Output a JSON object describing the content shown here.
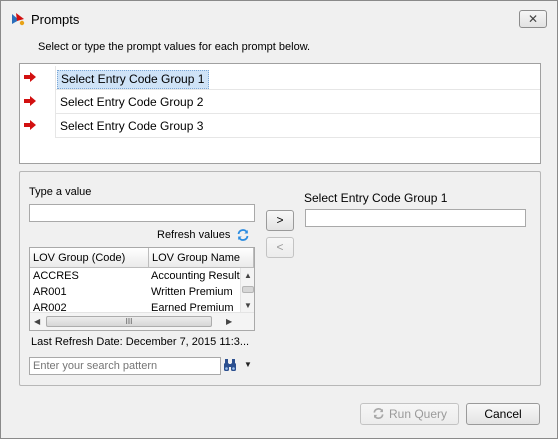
{
  "window": {
    "title": "Prompts",
    "close_symbol": "✕"
  },
  "instruction": "Select or type the prompt values for each prompt below.",
  "prompts": [
    {
      "label": "Select Entry Code Group 1",
      "selected": true
    },
    {
      "label": "Select Entry Code Group 2",
      "selected": false
    },
    {
      "label": "Select Entry Code Group 3",
      "selected": false
    }
  ],
  "left_panel": {
    "type_value_label": "Type a value",
    "type_value_input": "",
    "refresh_values_label": "Refresh values",
    "table": {
      "columns": [
        "LOV Group (Code)",
        "LOV Group Name"
      ],
      "rows": [
        [
          "ACCRES",
          "Accounting Result"
        ],
        [
          "AR001",
          "Written Premium"
        ],
        [
          "AR002",
          "Earned Premium"
        ]
      ],
      "hscroll_thumb_text": "III"
    },
    "last_refresh": "Last Refresh Date: December 7, 2015 11:3...",
    "search_placeholder": "Enter your search pattern"
  },
  "transfer": {
    "add_symbol": ">",
    "remove_symbol": "<"
  },
  "right_panel": {
    "label": "Select Entry Code Group 1",
    "value": ""
  },
  "footer": {
    "run_query_label": "Run Query",
    "cancel_label": "Cancel"
  },
  "colors": {
    "arrow": "#d21010",
    "selection": "#cfe3f7",
    "accent": "#2a6ebb"
  }
}
